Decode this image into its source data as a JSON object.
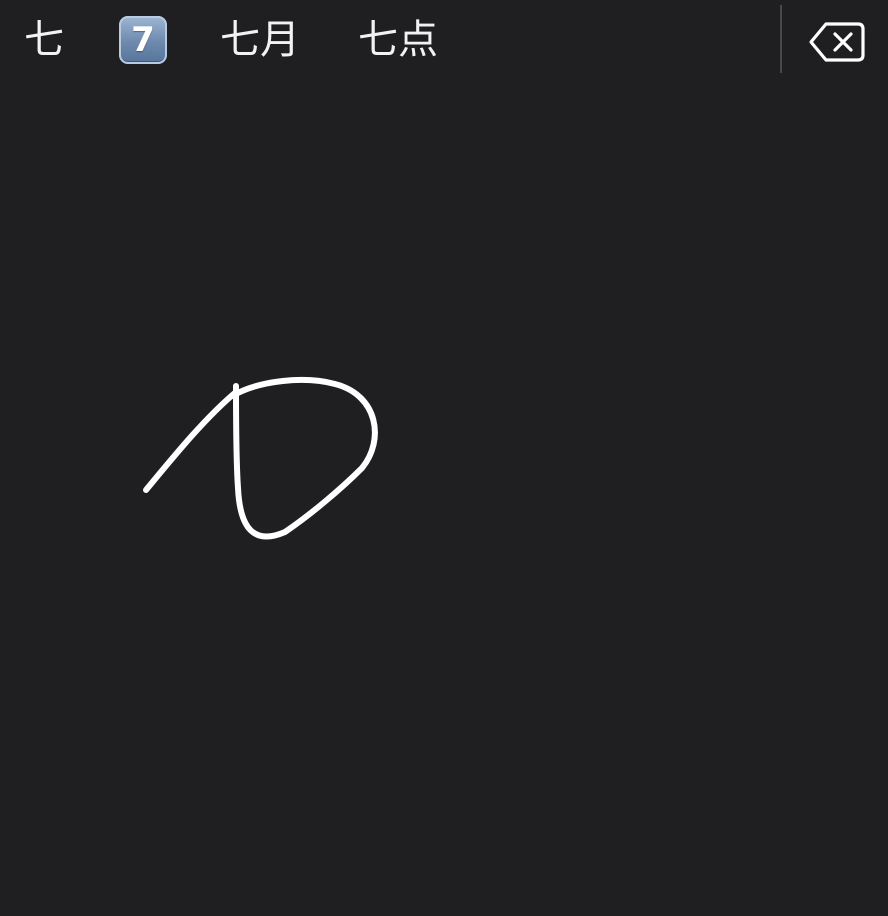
{
  "candidate_bar": {
    "candidates": [
      {
        "label": "七"
      },
      {
        "label": "7",
        "icon": "keycap-digit-seven-emoji"
      },
      {
        "label": "七月"
      },
      {
        "label": "七点"
      }
    ],
    "delete_icon": "backspace-delete-icon"
  },
  "handwriting_canvas": {
    "stroke_color": "#ffffff",
    "background": "#1f1e21"
  }
}
